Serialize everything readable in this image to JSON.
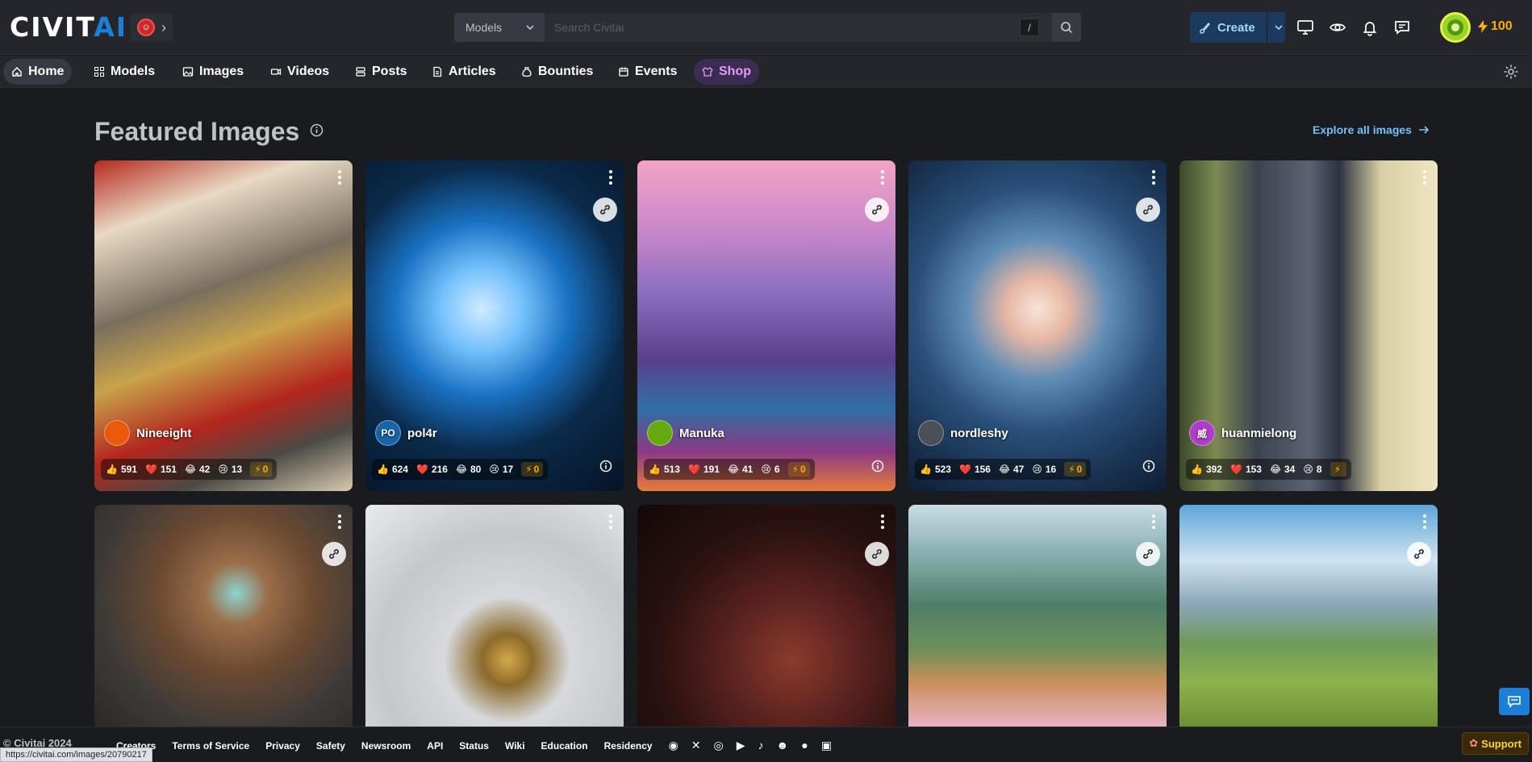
{
  "header": {
    "logo_main": "CIVIT",
    "logo_accent": "AI",
    "search": {
      "scope": "Models",
      "placeholder": "Search Civitai",
      "shortcut": "/"
    },
    "create_label": "Create",
    "buzz_amount": "100"
  },
  "nav": {
    "items": [
      {
        "label": "Home",
        "icon": "home-icon"
      },
      {
        "label": "Models",
        "icon": "grid-icon"
      },
      {
        "label": "Images",
        "icon": "image-icon"
      },
      {
        "label": "Videos",
        "icon": "video-icon"
      },
      {
        "label": "Posts",
        "icon": "posts-icon"
      },
      {
        "label": "Articles",
        "icon": "article-icon"
      },
      {
        "label": "Bounties",
        "icon": "moneybag-icon"
      },
      {
        "label": "Events",
        "icon": "calendar-icon"
      },
      {
        "label": "Shop",
        "icon": "shirt-icon"
      }
    ]
  },
  "main": {
    "title": "Featured Images",
    "explore_label": "Explore all images"
  },
  "cards": [
    {
      "user": "Nineeight",
      "avatar_text": "",
      "avatar_color": "#e8590c",
      "likes": "591",
      "hearts": "151",
      "laughs": "42",
      "cries": "13",
      "buzz": "0"
    },
    {
      "user": "pol4r",
      "avatar_text": "PO",
      "avatar_color": "#1864ab",
      "likes": "624",
      "hearts": "216",
      "laughs": "80",
      "cries": "17",
      "buzz": "0"
    },
    {
      "user": "Manuka",
      "avatar_text": "",
      "avatar_color": "#66a80f",
      "likes": "513",
      "hearts": "191",
      "laughs": "41",
      "cries": "6",
      "buzz": "0"
    },
    {
      "user": "nordleshy",
      "avatar_text": "",
      "avatar_color": "#495057",
      "likes": "523",
      "hearts": "156",
      "laughs": "47",
      "cries": "16",
      "buzz": "0"
    },
    {
      "user": "huanmielong",
      "avatar_text": "威",
      "avatar_color": "#ae3ec9",
      "likes": "392",
      "hearts": "153",
      "laughs": "34",
      "cries": "8",
      "buzz": ""
    }
  ],
  "footer": {
    "copyright": "© Civitai 2024",
    "links": [
      "Creators",
      "Terms of Service",
      "Privacy",
      "Safety",
      "Newsroom",
      "API",
      "Status",
      "Wiki",
      "Education",
      "Residency"
    ],
    "social_icons": [
      "discord-icon",
      "x-icon",
      "instagram-icon",
      "youtube-icon",
      "tiktok-icon",
      "reddit-icon",
      "github-icon",
      "twitch-icon"
    ],
    "support_label": "Support",
    "status_url": "https://civitai.com/images/20790217"
  },
  "colors": {
    "accent": "#1c7ed6",
    "buzz": "#fab005",
    "shop": "#e599f7"
  }
}
